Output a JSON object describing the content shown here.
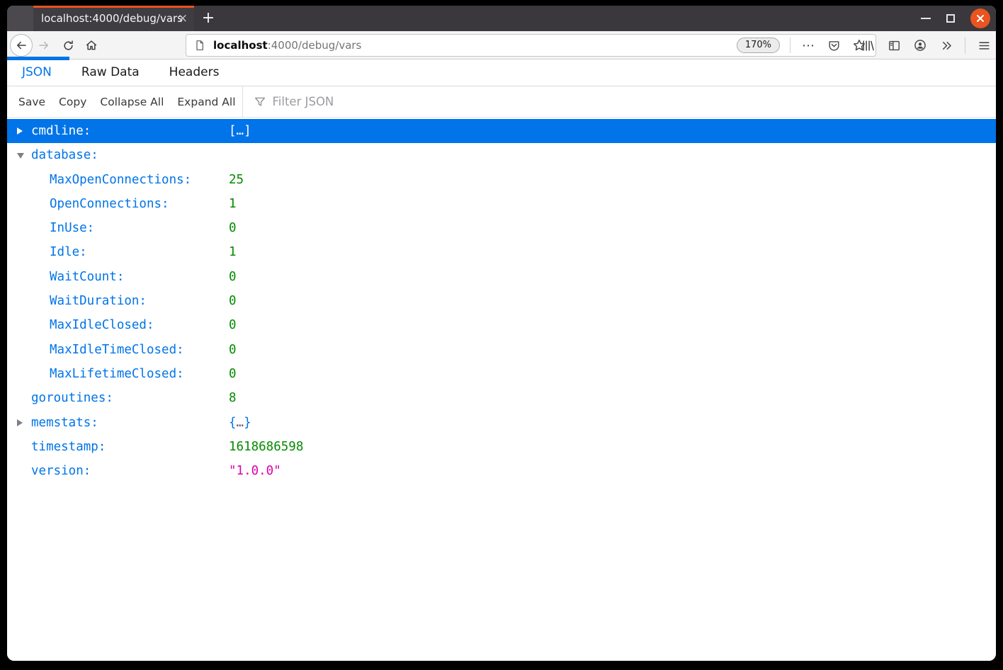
{
  "titlebar": {
    "tab_title": "localhost:4000/debug/vars",
    "tab_close_glyph": "×",
    "new_tab_glyph": "+"
  },
  "navbar": {
    "url_domain": "localhost",
    "url_path": ":4000/debug/vars",
    "zoom_level": "170%",
    "ellipsis_glyph": "⋯"
  },
  "viewer": {
    "tabs": [
      {
        "label": "JSON",
        "active": true
      },
      {
        "label": "Raw Data",
        "active": false
      },
      {
        "label": "Headers",
        "active": false
      }
    ],
    "toolbar": {
      "save": "Save",
      "copy": "Copy",
      "collapse_all": "Collapse All",
      "expand_all": "Expand All",
      "filter_placeholder": "Filter JSON"
    },
    "rows": [
      {
        "key": "cmdline:",
        "value": "[…]",
        "type": "collapsed-array",
        "level": 0,
        "arrow": "collapsed",
        "selected": true
      },
      {
        "key": "database:",
        "value": "",
        "type": "expanded-object",
        "level": 0,
        "arrow": "expanded",
        "selected": false
      },
      {
        "key": "MaxOpenConnections:",
        "value": "25",
        "type": "number",
        "level": 1,
        "selected": false
      },
      {
        "key": "OpenConnections:",
        "value": "1",
        "type": "number",
        "level": 1,
        "selected": false
      },
      {
        "key": "InUse:",
        "value": "0",
        "type": "number",
        "level": 1,
        "selected": false
      },
      {
        "key": "Idle:",
        "value": "1",
        "type": "number",
        "level": 1,
        "selected": false
      },
      {
        "key": "WaitCount:",
        "value": "0",
        "type": "number",
        "level": 1,
        "selected": false
      },
      {
        "key": "WaitDuration:",
        "value": "0",
        "type": "number",
        "level": 1,
        "selected": false
      },
      {
        "key": "MaxIdleClosed:",
        "value": "0",
        "type": "number",
        "level": 1,
        "selected": false
      },
      {
        "key": "MaxIdleTimeClosed:",
        "value": "0",
        "type": "number",
        "level": 1,
        "selected": false
      },
      {
        "key": "MaxLifetimeClosed:",
        "value": "0",
        "type": "number",
        "level": 1,
        "selected": false
      },
      {
        "key": "goroutines:",
        "value": "8",
        "type": "number",
        "level": 0,
        "selected": false
      },
      {
        "key": "memstats:",
        "value_open": "{",
        "value_dots": "…",
        "value_close": "}",
        "type": "collapsed-object",
        "level": 0,
        "arrow": "collapsed",
        "selected": false
      },
      {
        "key": "timestamp:",
        "value": "1618686598",
        "type": "number",
        "level": 0,
        "selected": false
      },
      {
        "key": "version:",
        "value": "\"1.0.0\"",
        "type": "string",
        "level": 0,
        "selected": false
      }
    ]
  },
  "colors": {
    "selection_blue": "#0074e8",
    "key_blue": "#0074e8",
    "number_green": "#058b00",
    "string_magenta": "#dd00a9",
    "accent_orange": "#e95420",
    "titlebar_dark": "#3a383c"
  }
}
